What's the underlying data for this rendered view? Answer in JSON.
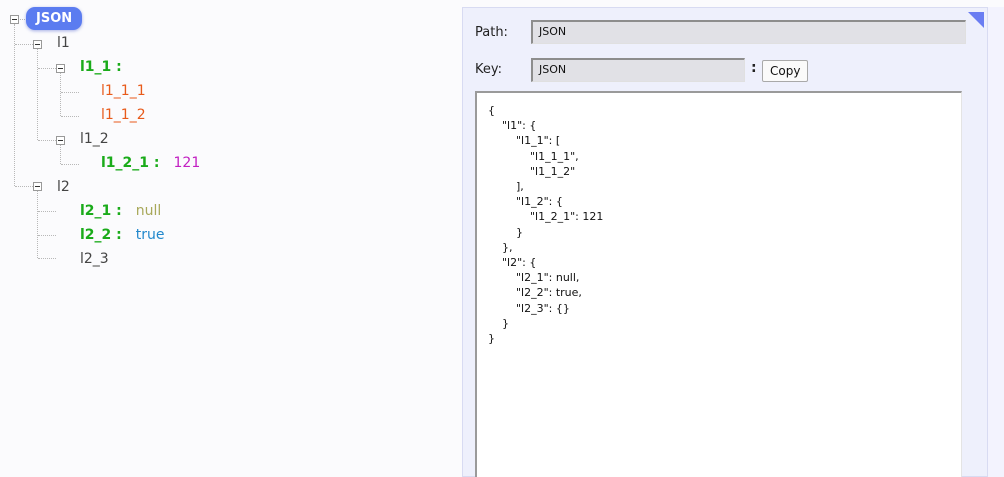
{
  "tree": {
    "root": "JSON",
    "l1": "l1",
    "l1_1": "l1_1 :",
    "l1_1_1": "l1_1_1",
    "l1_1_2": "l1_1_2",
    "l1_2": "l1_2",
    "l1_2_1": "l1_2_1 :",
    "l1_2_1_value": "121",
    "l2": "l2",
    "l2_1": "l2_1 :",
    "l2_1_value": "null",
    "l2_2": "l2_2 :",
    "l2_2_value": "true",
    "l2_3": "l2_3"
  },
  "panel": {
    "path_label": "Path:",
    "path_value": "JSON",
    "key_label": "Key:",
    "key_value": "JSON",
    "colon": ":",
    "copy_label": "Copy",
    "json_text": "{\n    \"l1\": {\n        \"l1_1\": [\n            \"l1_1_1\",\n            \"l1_1_2\"\n        ],\n        \"l1_2\": {\n            \"l1_2_1\": 121\n        }\n    },\n    \"l2\": {\n        \"l2_1\": null,\n        \"l2_2\": true,\n        \"l2_3\": {}\n    }\n}"
  },
  "colors": {
    "root_pill": "#5b7cf0",
    "key_green": "#1aab1a",
    "leaf_red": "#e85a1a",
    "number": "#c21fc2",
    "null": "#a8a85a",
    "boolean": "#2288cc",
    "corner_accent": "#6a7df2"
  }
}
